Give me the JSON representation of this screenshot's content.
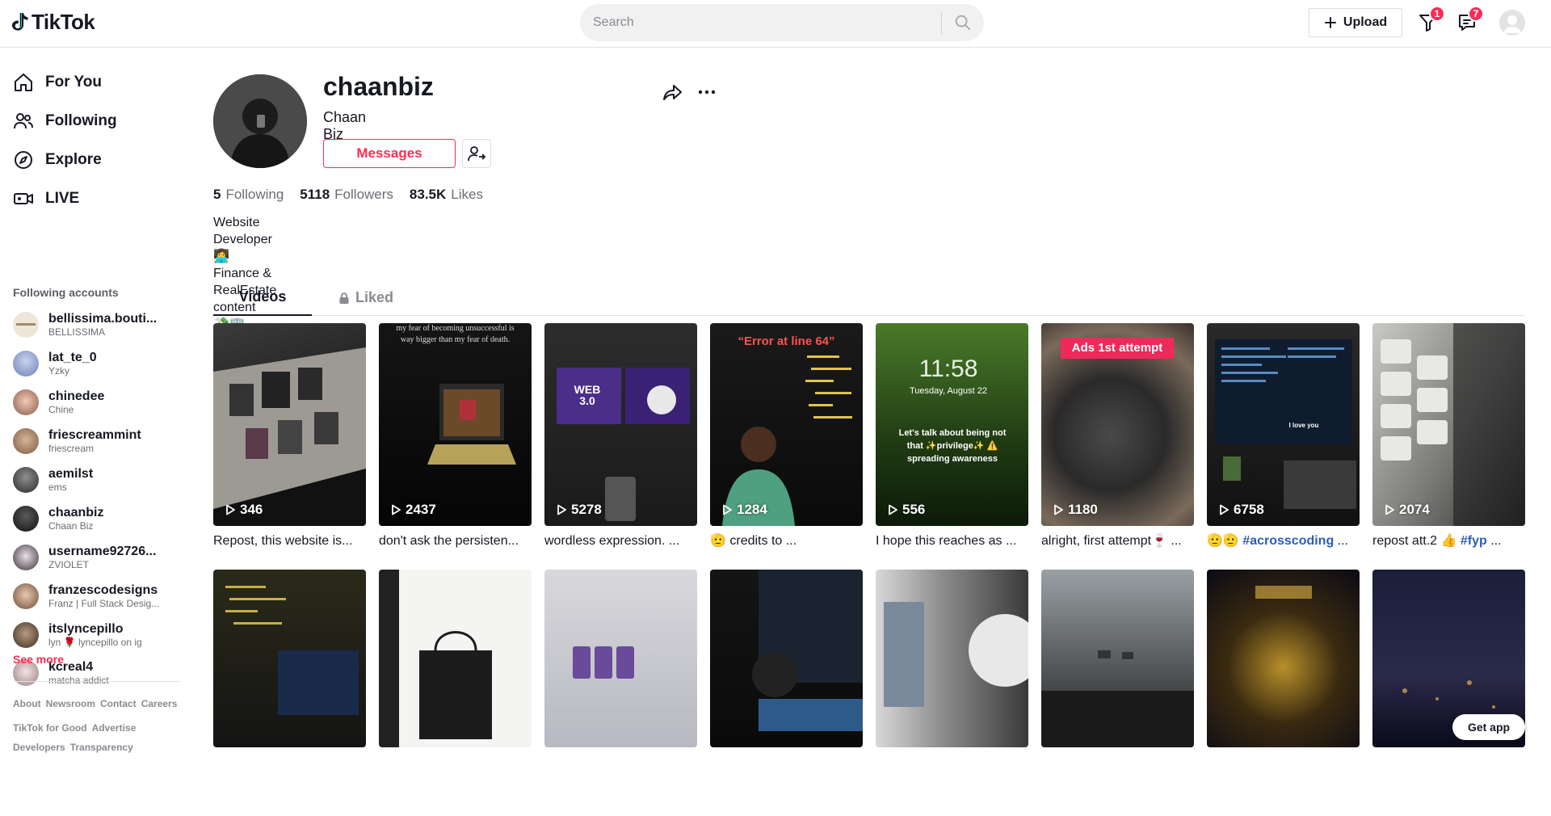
{
  "header": {
    "logo": "TikTok",
    "search_placeholder": "Search",
    "upload_label": "Upload",
    "inbox_badge": "1",
    "messages_badge": "7"
  },
  "sidebar": {
    "nav": [
      {
        "label": "For You",
        "icon": "home-icon"
      },
      {
        "label": "Following",
        "icon": "users-icon"
      },
      {
        "label": "Explore",
        "icon": "compass-icon"
      },
      {
        "label": "LIVE",
        "icon": "live-icon"
      }
    ],
    "following_heading": "Following accounts",
    "accounts": [
      {
        "name": "bellissima.bouti...",
        "sub": "BELLISSIMA"
      },
      {
        "name": "lat_te_0",
        "sub": "Yzky"
      },
      {
        "name": "chinedee",
        "sub": "Chine"
      },
      {
        "name": "friescreammint",
        "sub": "friescream"
      },
      {
        "name": "aemilst",
        "sub": "ems"
      },
      {
        "name": "chaanbiz",
        "sub": "Chaan Biz"
      },
      {
        "name": "username92726...",
        "sub": "ZVIOLET"
      },
      {
        "name": "franzescodesigns",
        "sub": "Franz | Full Stack Desig..."
      },
      {
        "name": "itslyncepillo",
        "sub": "lyn 🌹 lyncepillo on ig"
      },
      {
        "name": "kcreal4",
        "sub": "matcha addict"
      }
    ],
    "see_more": "See more",
    "footer_row1": [
      "About",
      "Newsroom",
      "Contact",
      "Careers"
    ],
    "footer_row2": [
      "TikTok for Good",
      "Advertise"
    ],
    "footer_row3": [
      "Developers",
      "Transparency"
    ]
  },
  "profile": {
    "username": "chaanbiz",
    "nickname": "Chaan Biz",
    "messages_label": "Messages",
    "following_count": "5",
    "following_label": "Following",
    "followers_count": "5118",
    "followers_label": "Followers",
    "likes_count": "83.5K",
    "likes_label": "Likes",
    "bio_line1": "Website Developer 👩‍💻",
    "bio_line2": "Finance & RealEstate content",
    "bio_line3": "💸🏢"
  },
  "tabs": {
    "videos": "Videos",
    "liked": "Liked"
  },
  "videos_row1": [
    {
      "views": "346",
      "caption": "Repost, this website is...",
      "overlay": ""
    },
    {
      "views": "2437",
      "caption": "don't ask the persisten...",
      "overlay": "my fear of becoming unsuccessful is way bigger than my fear of death."
    },
    {
      "views": "5278",
      "caption": "wordless expression. ...",
      "overlay": "WEB 3.0"
    },
    {
      "views": "1284",
      "caption": "🫡 credits to ...",
      "overlay": "“Error at line 64”"
    },
    {
      "views": "556",
      "caption": "I hope this reaches as ...",
      "overlay": "Let's talk about being not that ✨privilege✨ ⚠️ spreading awareness",
      "clock": "11:58",
      "date": "Tuesday, August 22"
    },
    {
      "views": "1180",
      "caption": "alright, first attempt🍷 ...",
      "overlay": "Ads 1st attempt"
    },
    {
      "views": "6758",
      "caption": "🫡🫡 #acrosscoding ...",
      "overlay": "I love you"
    },
    {
      "views": "2074",
      "caption": "repost att.2 👍 #fyp ...",
      "overlay": ""
    }
  ],
  "videos_row2_count": 8,
  "get_app": "Get app"
}
